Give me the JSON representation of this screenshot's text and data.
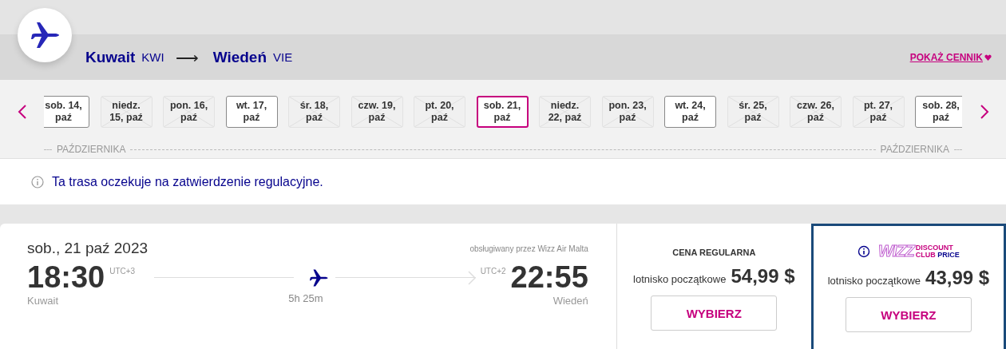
{
  "route": {
    "origin": {
      "city": "Kuwait",
      "code": "KWI"
    },
    "arrow": "⟶",
    "destination": {
      "city": "Wiedeń",
      "code": "VIE"
    },
    "price_list_link": "POKAŻ CENNIK"
  },
  "date_strip": {
    "dates": [
      {
        "line1": "sob. 14,",
        "line2": "paź",
        "available": true,
        "selected": false
      },
      {
        "line1": "niedz.",
        "line2": "15, paź",
        "available": false,
        "selected": false
      },
      {
        "line1": "pon. 16,",
        "line2": "paź",
        "available": false,
        "selected": false
      },
      {
        "line1": "wt. 17,",
        "line2": "paź",
        "available": true,
        "selected": false
      },
      {
        "line1": "śr. 18,",
        "line2": "paź",
        "available": false,
        "selected": false
      },
      {
        "line1": "czw. 19,",
        "line2": "paź",
        "available": false,
        "selected": false
      },
      {
        "line1": "pt. 20,",
        "line2": "paź",
        "available": false,
        "selected": false
      },
      {
        "line1": "sob. 21,",
        "line2": "paź",
        "available": true,
        "selected": true
      },
      {
        "line1": "niedz.",
        "line2": "22, paź",
        "available": false,
        "selected": false
      },
      {
        "line1": "pon. 23,",
        "line2": "paź",
        "available": false,
        "selected": false
      },
      {
        "line1": "wt. 24,",
        "line2": "paź",
        "available": true,
        "selected": false
      },
      {
        "line1": "śr. 25,",
        "line2": "paź",
        "available": false,
        "selected": false
      },
      {
        "line1": "czw. 26,",
        "line2": "paź",
        "available": false,
        "selected": false
      },
      {
        "line1": "pt. 27,",
        "line2": "paź",
        "available": false,
        "selected": false
      },
      {
        "line1": "sob. 28,",
        "line2": "paź",
        "available": true,
        "selected": false
      }
    ],
    "month_labels": [
      "PAŹDZIERNIKA",
      "PAŹDZIERNIKA"
    ]
  },
  "notice": "Ta trasa oczekuje na zatwierdzenie regulacyjne.",
  "flight": {
    "date": "sob., 21 paź 2023",
    "operator": "obsługiwany przez Wizz Air Malta",
    "departure_time": "18:30",
    "departure_tz": "UTC+3",
    "departure_city": "Kuwait",
    "duration": "5h 25m",
    "arrival_tz": "UTC+2",
    "arrival_time": "22:55",
    "arrival_city": "Wiedeń"
  },
  "fares": [
    {
      "kind": "regular",
      "title": "CENA REGULARNA",
      "label": "lotnisko początkowe",
      "price": "54,99 $",
      "button": "WYBIERZ",
      "selected": false
    },
    {
      "kind": "club",
      "brand": "WIZZ",
      "badge": [
        "DISCOUNT",
        "CLUB",
        "PRICE"
      ],
      "label": "lotnisko początkowe",
      "price": "43,99 $",
      "button": "WYBIERZ",
      "selected": true
    }
  ]
}
